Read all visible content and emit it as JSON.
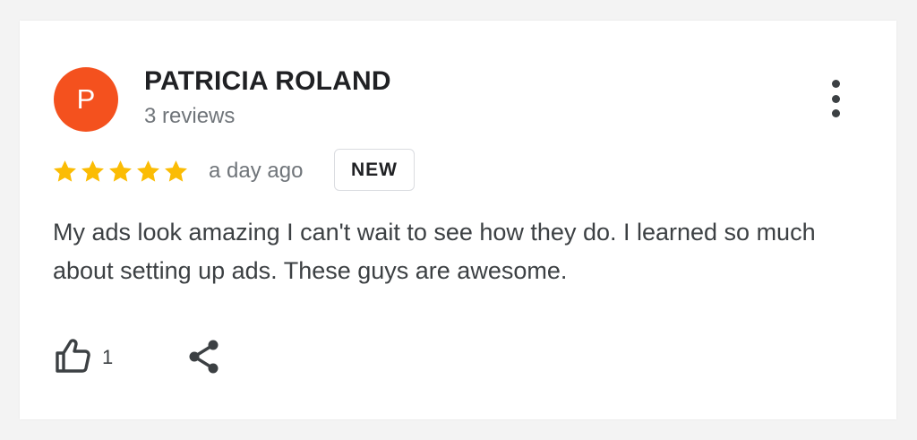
{
  "review": {
    "avatar_letter": "P",
    "author_name": "PATRICIA ROLAND",
    "author_reviews": "3 reviews",
    "rating": 5,
    "rating_max": 5,
    "date": "a day ago",
    "badge": "NEW",
    "text": "My ads look amazing I can't wait to see how they do. I learned so much about setting up ads. These guys are awesome.",
    "like_count": "1"
  },
  "icons": {
    "more": "more-vert-icon",
    "star": "star-icon",
    "like": "thumbs-up-icon",
    "share": "share-icon"
  },
  "colors": {
    "avatar_bg": "#f4511e",
    "star": "#fbbc04",
    "badge_border": "#dadce0"
  }
}
